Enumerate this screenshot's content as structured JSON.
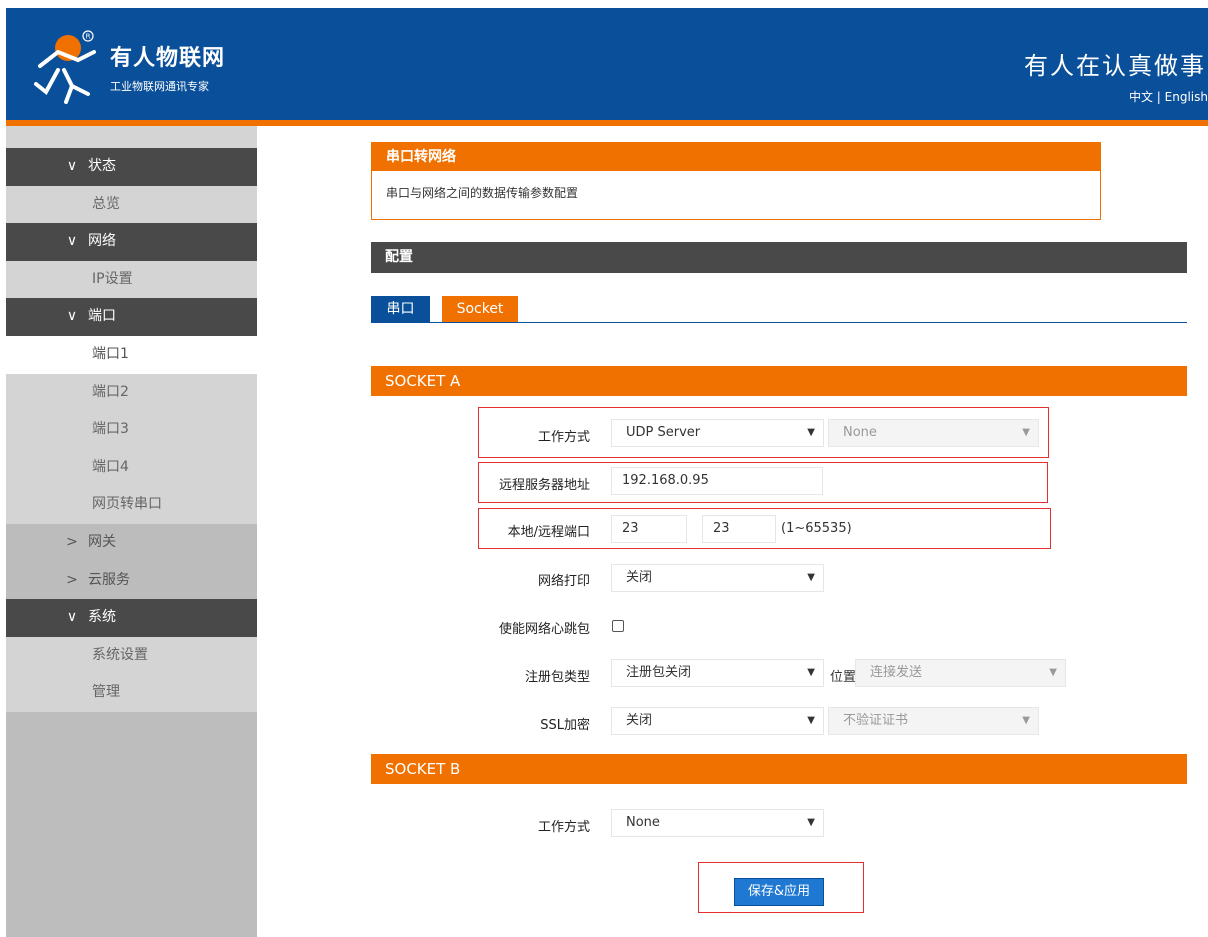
{
  "header": {
    "brand": "有人物联网",
    "tagline": "工业物联网通讯专家",
    "slogan": "有人在认真做事",
    "lang": "中文 | English"
  },
  "sidebar": {
    "items": [
      {
        "label": "状态",
        "type": "group",
        "icon": "chevron-down"
      },
      {
        "label": "总览",
        "type": "sub"
      },
      {
        "label": "网络",
        "type": "group",
        "icon": "chevron-down"
      },
      {
        "label": "IP设置",
        "type": "sub"
      },
      {
        "label": "端口",
        "type": "group",
        "icon": "chevron-down"
      },
      {
        "label": "端口1",
        "type": "sub",
        "active": true
      },
      {
        "label": "端口2",
        "type": "sub"
      },
      {
        "label": "端口3",
        "type": "sub"
      },
      {
        "label": "端口4",
        "type": "sub"
      },
      {
        "label": "网页转串口",
        "type": "sub"
      },
      {
        "label": "网关",
        "type": "collapsed",
        "icon": "chevron-right"
      },
      {
        "label": "云服务",
        "type": "collapsed",
        "icon": "chevron-right"
      },
      {
        "label": "系统",
        "type": "group",
        "icon": "chevron-down"
      },
      {
        "label": "系统设置",
        "type": "sub"
      },
      {
        "label": "管理",
        "type": "sub"
      }
    ]
  },
  "panel": {
    "title": "串口转网络",
    "desc": "串口与网络之间的数据传输参数配置"
  },
  "config": {
    "title": "配置",
    "tabs": [
      "串口",
      "Socket"
    ]
  },
  "socket_a": {
    "title": "SOCKET A",
    "work_mode": {
      "label": "工作方式",
      "value": "UDP Server",
      "secondary": "None"
    },
    "remote_addr": {
      "label": "远程服务器地址",
      "value": "192.168.0.95"
    },
    "ports": {
      "label": "本地/远程端口",
      "local": "23",
      "remote": "23",
      "range": "(1~65535)"
    },
    "net_print": {
      "label": "网络打印",
      "value": "关闭"
    },
    "heartbeat": {
      "label": "使能网络心跳包",
      "checked": false
    },
    "register": {
      "label": "注册包类型",
      "value": "注册包关闭",
      "pos_label": "位置",
      "pos_value": "连接发送"
    },
    "ssl": {
      "label": "SSL加密",
      "value": "关闭",
      "cert": "不验证证书"
    }
  },
  "socket_b": {
    "title": "SOCKET B",
    "work_mode": {
      "label": "工作方式",
      "value": "None"
    }
  },
  "save_label": "保存&应用",
  "colors": {
    "brand_blue": "#0a4f99",
    "accent_orange": "#f07100",
    "dark_bar": "#494949",
    "highlight_red": "#e03030"
  }
}
